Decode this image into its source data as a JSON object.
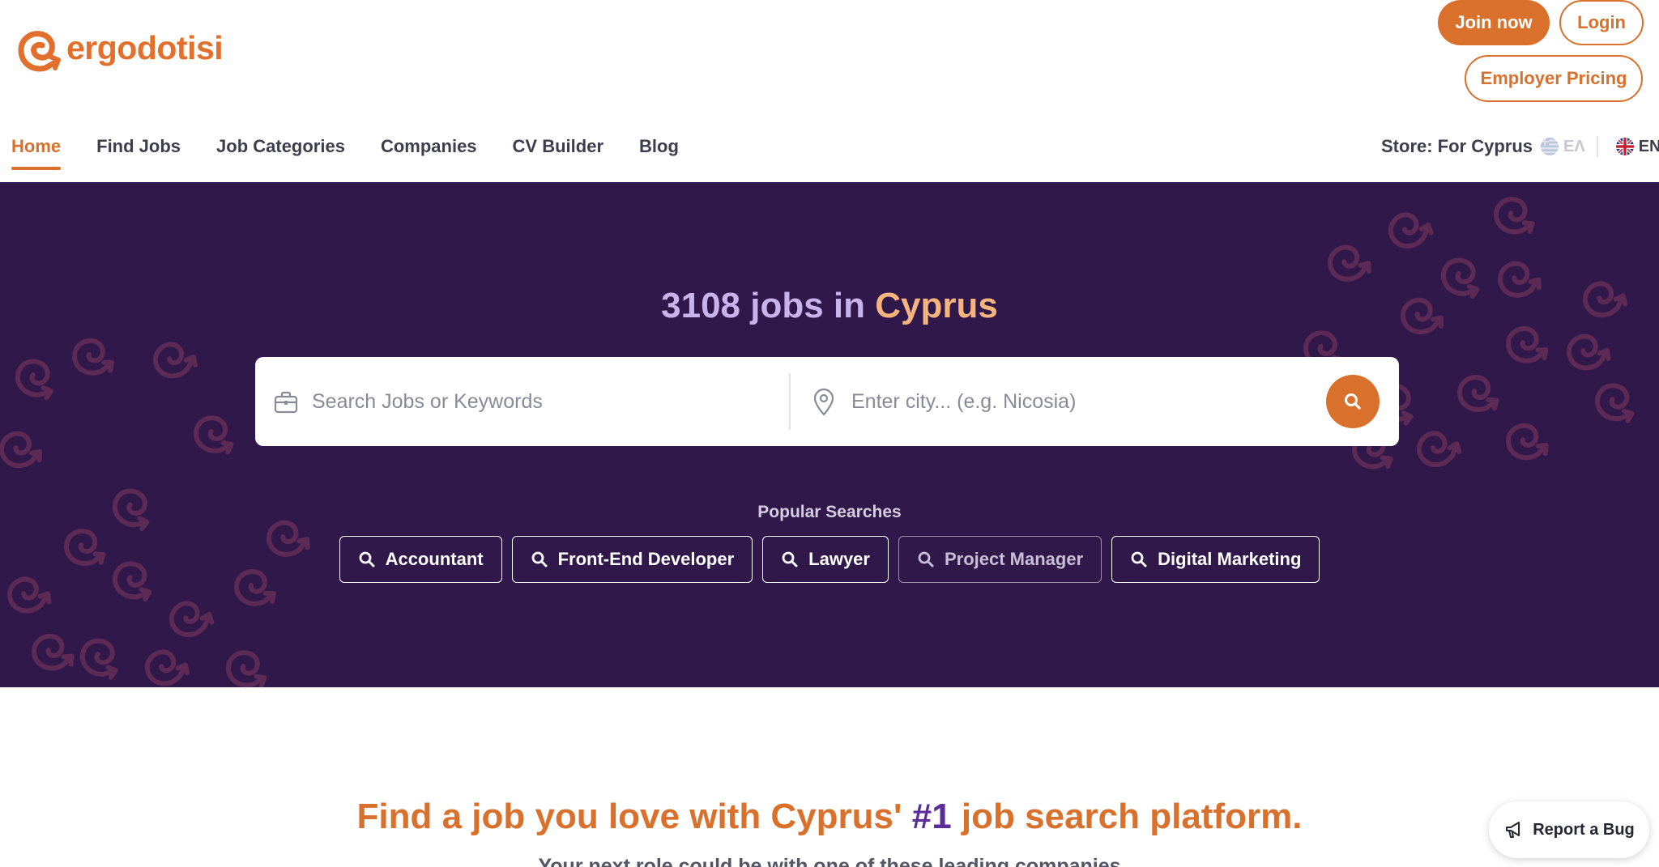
{
  "brand": {
    "name": "ergodotisi",
    "accent": "#d9712d",
    "hero_bg": "#31184a"
  },
  "header": {
    "join_label": "Join now",
    "login_label": "Login",
    "employer_label": "Employer Pricing"
  },
  "nav": {
    "items": [
      {
        "label": "Home",
        "active": true
      },
      {
        "label": "Find Jobs"
      },
      {
        "label": "Job Categories"
      },
      {
        "label": "Companies"
      },
      {
        "label": "CV Builder"
      },
      {
        "label": "Blog"
      }
    ]
  },
  "store": {
    "label": "Store: For Cyprus",
    "languages": [
      {
        "code": "EΛ",
        "icon": "greek-flag-icon",
        "selected": false
      },
      {
        "code": "EN",
        "icon": "uk-flag-icon",
        "selected": true
      }
    ]
  },
  "hero": {
    "title_count": "3108 jobs in",
    "title_place": "Cyprus",
    "search_placeholder": "Search Jobs or Keywords",
    "city_placeholder": "Enter city... (e.g. Nicosia)",
    "popular_label": "Popular Searches",
    "popular": [
      {
        "label": "Accountant"
      },
      {
        "label": "Front-End Developer"
      },
      {
        "label": "Lawyer"
      },
      {
        "label": "Project Manager"
      },
      {
        "label": "Digital Marketing"
      }
    ]
  },
  "tagline": {
    "before": "Find a job you love with Cyprus'",
    "number": "#1",
    "after": "job search platform.",
    "sub": "Your next role could be with one of these leading companies"
  },
  "report_bug": {
    "label": "Report a Bug"
  }
}
